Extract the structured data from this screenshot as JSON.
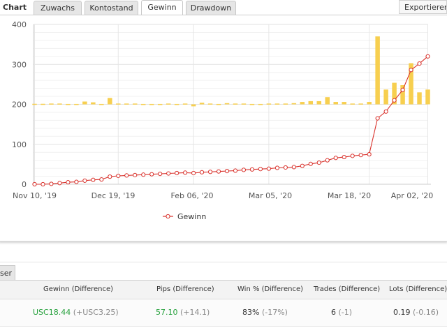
{
  "tabs": {
    "chart_label": "Chart",
    "items": [
      "Zuwachs",
      "Kontostand",
      "Gewinn",
      "Drawdown"
    ],
    "active": "Gewinn",
    "export_label": "Exportieren"
  },
  "chart_data": {
    "type": "line+bar",
    "ylim": [
      0,
      400
    ],
    "yticks": [
      "0",
      "100",
      "200",
      "300",
      "400"
    ],
    "xticks": [
      "Nov 10, '19",
      "Dec 19, '19",
      "Feb 06, '20",
      "Mar 05, '20",
      "Mar 18, '20",
      "Apr 02, '20"
    ],
    "grid": true,
    "legend_position": "bottom-center",
    "series": [
      {
        "name": "Gewinn",
        "kind": "line",
        "color": "#d9322c",
        "values": [
          0,
          0,
          1,
          3,
          5,
          6,
          9,
          11,
          12,
          19,
          21,
          22,
          23,
          24,
          25,
          26,
          27,
          28,
          29,
          28,
          30,
          31,
          32,
          33,
          34,
          36,
          37,
          38,
          39,
          41,
          42,
          43,
          46,
          51,
          54,
          60,
          66,
          68,
          71,
          73,
          75,
          165,
          182,
          210,
          236,
          286,
          302,
          320
        ]
      },
      {
        "kind": "bar",
        "color": "#f7cf4f",
        "baseline": 200,
        "values": [
          0,
          0,
          2,
          2,
          1,
          1,
          7,
          5,
          1,
          16,
          2,
          2,
          2,
          1,
          1,
          1,
          2,
          1,
          2,
          -5,
          4,
          2,
          1,
          3,
          2,
          2,
          1,
          1,
          2,
          2,
          2,
          3,
          6,
          8,
          8,
          18,
          6,
          6,
          2,
          2,
          6,
          170,
          37,
          54,
          48,
          103,
          30,
          37
        ]
      }
    ]
  },
  "stats": {
    "headers": [
      "Gewinn (Difference)",
      "Pips (Difference)",
      "Win % (Difference)",
      "Trades (Difference)",
      "Lots (Difference)"
    ],
    "row": {
      "gewinn": "USC18.44",
      "gewinn_diff": "(+USC3.25)",
      "pips": "57.10",
      "pips_diff": "(+14.1)",
      "win": "83%",
      "win_diff": "(-17%)",
      "trades": "6",
      "trades_diff": "(-1)",
      "lots": "0.19",
      "lots_diff": "(-0.16)"
    }
  },
  "lower_tab_label": "ser"
}
